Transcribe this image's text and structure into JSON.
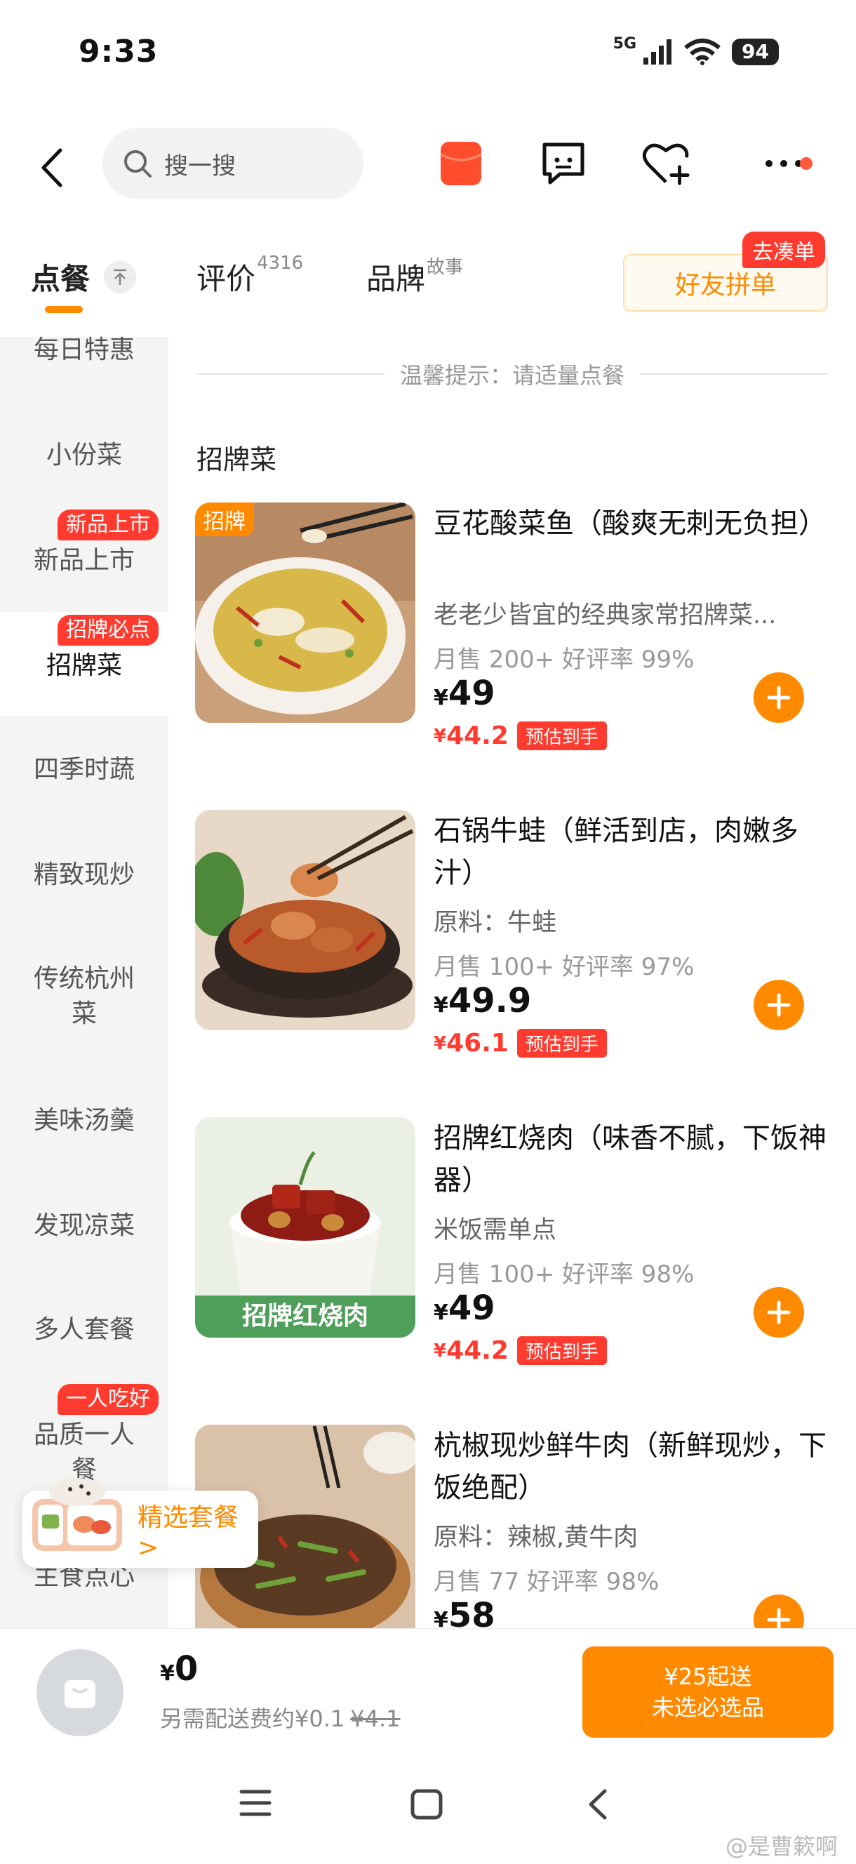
{
  "status_bar": {
    "time": "9:33",
    "network": "5G",
    "battery": "94"
  },
  "header": {
    "search_placeholder": "搜一搜"
  },
  "tabs": {
    "order": {
      "label": "点餐"
    },
    "reviews": {
      "label": "评价",
      "count": "4316"
    },
    "brand": {
      "label": "品牌",
      "sup": "故事"
    },
    "friend_order": {
      "label": "好友拼单",
      "tag": "去凑单"
    }
  },
  "sidebar": {
    "items": [
      {
        "label": "每日特惠"
      },
      {
        "label": "小份菜"
      },
      {
        "label": "新品上市",
        "badge": "新品上市"
      },
      {
        "label": "招牌菜",
        "badge": "招牌必点"
      },
      {
        "label": "四季时蔬"
      },
      {
        "label": "精致现炒"
      },
      {
        "label": "传统杭州菜"
      },
      {
        "label": "美味汤羹"
      },
      {
        "label": "发现凉菜"
      },
      {
        "label": "多人套餐"
      },
      {
        "label": "品质一人餐",
        "badge": "一人吃好"
      },
      {
        "label": "主食点心"
      }
    ]
  },
  "main": {
    "tip": "温馨提示：请适量点餐",
    "section_title": "招牌菜",
    "dishes": [
      {
        "name": "豆花酸菜鱼（酸爽无刺无负担）",
        "desc": "老老少皆宜的经典家常招牌菜...",
        "sales": "月售 200+ 好评率 99%",
        "currency": "¥",
        "price": "49",
        "est_price": "44.2",
        "est_tag": "预估到手",
        "img_tag": "招牌"
      },
      {
        "name": "石锅牛蛙（鲜活到店，肉嫩多汁）",
        "desc": "原料：牛蛙",
        "sales": "月售 100+ 好评率 97%",
        "currency": "¥",
        "price": "49.9",
        "est_price": "46.1",
        "est_tag": "预估到手"
      },
      {
        "name": "招牌红烧肉（味香不腻，下饭神器）",
        "desc": "米饭需单点",
        "sales": "月售 100+ 好评率 98%",
        "currency": "¥",
        "price": "49",
        "est_price": "44.2",
        "est_tag": "预估到手",
        "img_banner": "招牌红烧肉"
      },
      {
        "name": "杭椒现炒鲜牛肉（新鲜现炒，下饭绝配）",
        "desc": "原料：辣椒,黄牛肉",
        "sales": "月售 77 好评率 98%",
        "currency": "¥",
        "price": "58"
      }
    ]
  },
  "combo": {
    "label": "精选套餐 >"
  },
  "cart": {
    "currency": "¥",
    "total": "0",
    "fee_text": "另需配送费约¥0.1",
    "fee_original": "¥4.1",
    "checkout_line1": "¥25起送",
    "checkout_line2": "未选必选品"
  },
  "watermark": "@是曹簌啊",
  "colors": {
    "accent": "#ff8a00",
    "badge_red": "#ff3b2f",
    "sidebar_bg": "#f4f4f4"
  },
  "icons": [
    "back-icon",
    "search-icon",
    "red-packet-icon",
    "chat-icon",
    "favorite-add-icon",
    "more-icon",
    "pin-top-icon",
    "add-icon",
    "cart-bag-icon",
    "menu-icon",
    "home-icon",
    "nav-back-icon"
  ]
}
